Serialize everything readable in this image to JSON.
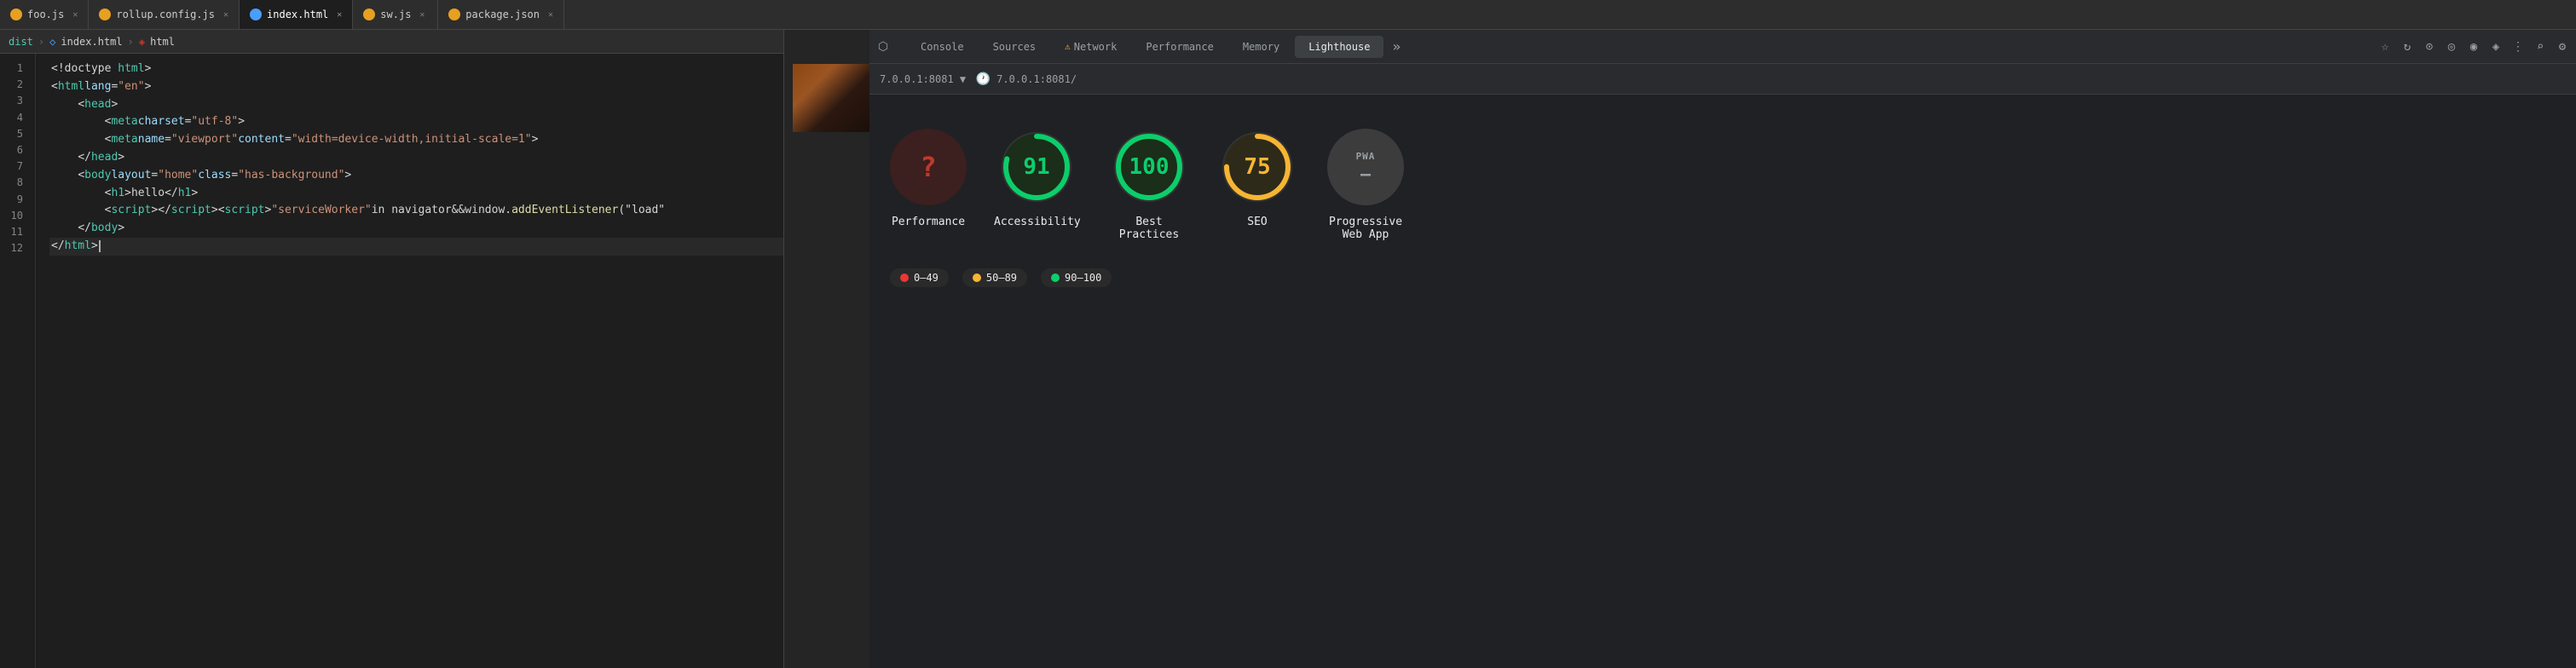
{
  "tabs": [
    {
      "id": "foo-js",
      "label": "foo.js",
      "icon": "orange",
      "active": false
    },
    {
      "id": "rollup-config",
      "label": "rollup.config.js",
      "icon": "orange",
      "active": false
    },
    {
      "id": "index-html",
      "label": "index.html",
      "icon": "blue",
      "active": true
    },
    {
      "id": "sw-js",
      "label": "sw.js",
      "icon": "orange",
      "active": false
    },
    {
      "id": "package-json",
      "label": "package.json",
      "icon": "orange",
      "active": false
    }
  ],
  "breadcrumb": {
    "items": [
      "dist",
      ">",
      "index.html",
      ">",
      "html"
    ]
  },
  "code": {
    "lines": [
      {
        "num": 1,
        "html": "<span class='t-punct'>&lt;!doctype </span><span class='t-tag'>html</span><span class='t-punct'>&gt;</span>"
      },
      {
        "num": 2,
        "html": "<span class='t-punct'>&lt;</span><span class='t-tag'>html</span> <span class='t-attr'>lang</span><span class='t-punct'>=</span><span class='t-val'>\"en\"</span><span class='t-punct'>&gt;</span>"
      },
      {
        "num": 3,
        "html": "    <span class='t-punct'>&lt;</span><span class='t-tag'>head</span><span class='t-punct'>&gt;</span>"
      },
      {
        "num": 4,
        "html": "        <span class='t-punct'>&lt;</span><span class='t-tag'>meta</span> <span class='t-attr'>charset</span><span class='t-punct'>=</span><span class='t-val'>\"utf-8\"</span><span class='t-punct'>&gt;</span>"
      },
      {
        "num": 5,
        "html": "        <span class='t-punct'>&lt;</span><span class='t-tag'>meta</span> <span class='t-attr'>name</span><span class='t-punct'>=</span><span class='t-val'>\"viewport\"</span> <span class='t-attr'>content</span><span class='t-punct'>=</span><span class='t-val'>\"width=device-width,initial-scale=1\"</span><span class='t-punct'>&gt;</span>"
      },
      {
        "num": 6,
        "html": "    <span class='t-punct'>&lt;/</span><span class='t-tag'>head</span><span class='t-punct'>&gt;</span>"
      },
      {
        "num": 7,
        "html": "    <span class='t-punct'>&lt;</span><span class='t-tag'>body</span> <span class='t-attr'>layout</span><span class='t-punct'>=</span><span class='t-val'>\"home\"</span> <span class='t-attr'>class</span><span class='t-punct'>=</span><span class='t-val'>\"has-background\"</span><span class='t-punct'>&gt;</span>"
      },
      {
        "num": 8,
        "html": "        <span class='t-punct'>&lt;</span><span class='t-tag'>h1</span><span class='t-punct'>&gt;</span><span class='t-text'>hello</span><span class='t-punct'>&lt;/</span><span class='t-tag'>h1</span><span class='t-punct'>&gt;</span>"
      },
      {
        "num": 9,
        "html": ""
      },
      {
        "num": 10,
        "html": "        <span class='t-punct'>&lt;</span><span class='t-tag'>script</span><span class='t-punct'>&gt;&lt;/</span><span class='t-tag'>script</span><span class='t-punct'>&gt;&lt;</span><span class='t-tag'>script</span><span class='t-punct'>&gt;</span><span class='t-val'>\"serviceWorker\"</span><span class='t-text'>in navigator&amp;&amp;window.</span><span class='t-fn'>addEventListener</span><span class='t-punct'>(</span><span class='t-val'>\"load\"</span>"
      },
      {
        "num": 11,
        "html": "    <span class='t-punct'>&lt;/</span><span class='t-tag'>body</span><span class='t-punct'>&gt;</span>"
      },
      {
        "num": 12,
        "html": "<span class='t-punct'>&lt;/</span><span class='t-tag'>html</span><span class='t-punct'>&gt;</span>",
        "cursor": true
      }
    ]
  },
  "devtools": {
    "tabs": [
      {
        "id": "console",
        "label": "Console",
        "active": false,
        "warning": false
      },
      {
        "id": "sources",
        "label": "Sources",
        "active": false,
        "warning": false
      },
      {
        "id": "network",
        "label": "Network",
        "active": false,
        "warning": true
      },
      {
        "id": "performance",
        "label": "Performance",
        "active": false,
        "warning": false
      },
      {
        "id": "memory",
        "label": "Memory",
        "active": false,
        "warning": false
      },
      {
        "id": "lighthouse",
        "label": "Lighthouse",
        "active": true,
        "warning": false
      }
    ],
    "more_tabs_icon": "»",
    "url": "7.0.0.1:8081/",
    "url_prefix": "7.0.0.1:8081 ▼"
  },
  "lighthouse": {
    "scores": [
      {
        "id": "performance",
        "label": "Performance",
        "value": "?",
        "type": "question",
        "color": "#c0392b",
        "bg": "#3c1f1f",
        "ring_color": null,
        "score": 0
      },
      {
        "id": "accessibility",
        "label": "Accessibility",
        "value": "91",
        "type": "ring",
        "ring_color": "#0cce6b",
        "bg": "#1a2e1a",
        "score": 91
      },
      {
        "id": "best-practices",
        "label": "Best Practices",
        "value": "100",
        "type": "ring",
        "ring_color": "#0cce6b",
        "bg": "#1a2e1a",
        "score": 100
      },
      {
        "id": "seo",
        "label": "SEO",
        "value": "75",
        "type": "ring",
        "ring_color": "#f6b533",
        "bg": "#2e2a1a",
        "score": 75
      },
      {
        "id": "pwa",
        "label": "Progressive Web App",
        "value": "PWA",
        "type": "pwa",
        "ring_color": null,
        "bg": "#3c3c3c",
        "score": null
      }
    ],
    "legend": [
      {
        "id": "fail",
        "label": "0–49",
        "color": "red"
      },
      {
        "id": "average",
        "label": "50–89",
        "color": "orange"
      },
      {
        "id": "pass",
        "label": "90–100",
        "color": "green"
      }
    ]
  }
}
